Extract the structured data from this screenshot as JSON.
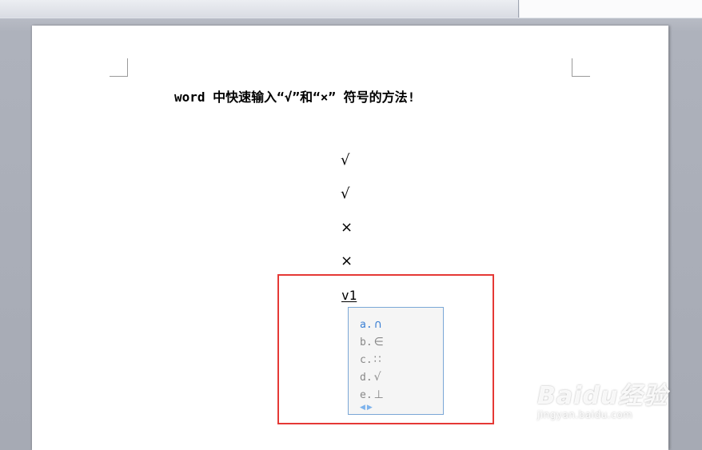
{
  "document": {
    "title": "word 中快速输入“√”和“×” 符号的方法!",
    "lines": [
      "√",
      "√",
      "×",
      "×"
    ],
    "typed_input": "v1"
  },
  "ime_candidates": {
    "items": [
      {
        "key": "a.",
        "symbol": "∩"
      },
      {
        "key": "b.",
        "symbol": "∈"
      },
      {
        "key": "c.",
        "symbol": "∷"
      },
      {
        "key": "d.",
        "symbol": "√"
      },
      {
        "key": "e.",
        "symbol": "⊥"
      }
    ],
    "nav": "◀▶"
  },
  "watermark": {
    "logo": "Baidu经验",
    "url": "jingyan.baidu.com"
  },
  "colors": {
    "highlight_border": "#e53935",
    "candidate_active": "#3a7fd4",
    "candidate_border": "#7aa7d6"
  }
}
